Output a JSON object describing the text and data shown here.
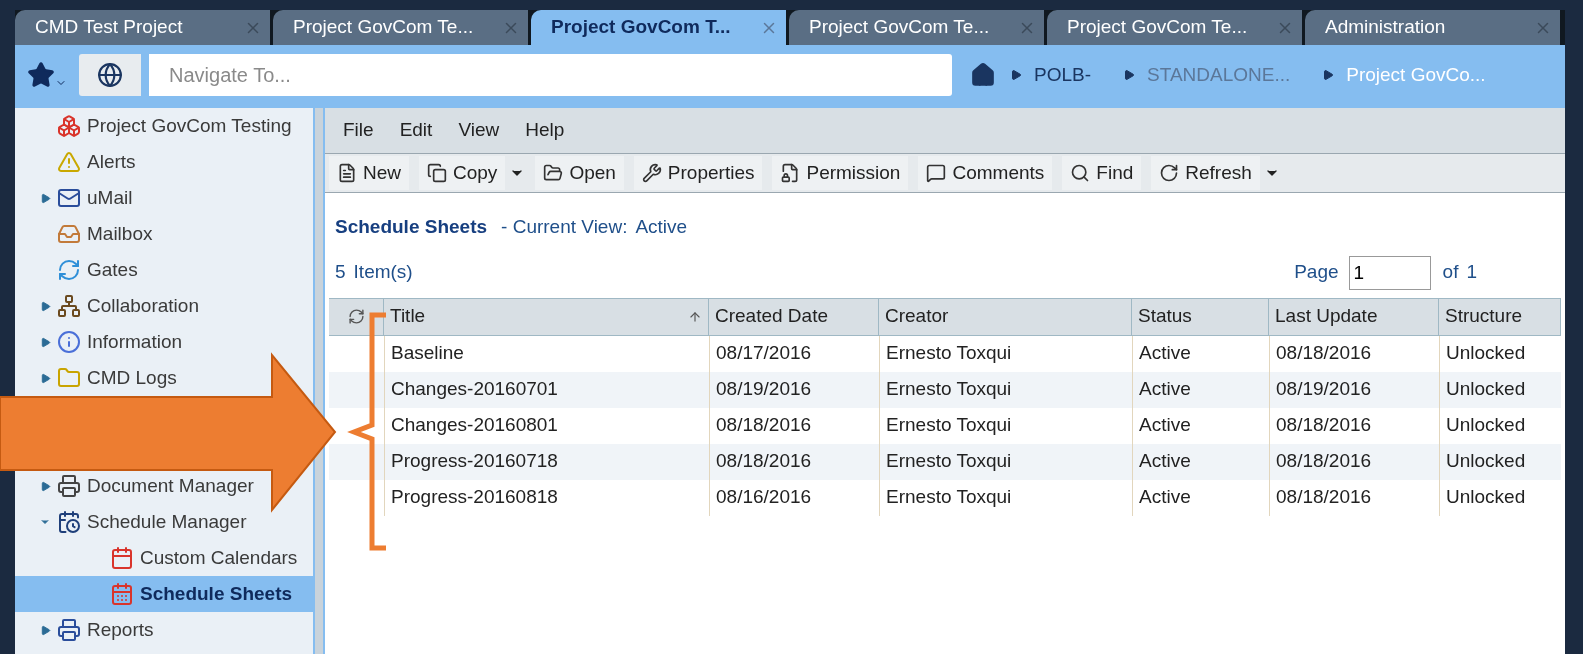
{
  "tabs": [
    {
      "label": "CMD Test Project",
      "selected": false
    },
    {
      "label": "Project GovCom Te...",
      "selected": false
    },
    {
      "label": "Project GovCom T...",
      "selected": true
    },
    {
      "label": "Project GovCom Te...",
      "selected": false
    },
    {
      "label": "Project GovCom Te...",
      "selected": false
    },
    {
      "label": "Administration",
      "selected": false
    }
  ],
  "navigation": {
    "placeholder": "Navigate To...",
    "breadcrumbs": [
      {
        "label": "POLB-",
        "color": "#1a3560"
      },
      {
        "label": "STANDALONE...",
        "color": "#5b7799"
      },
      {
        "label": "Project GovCo...",
        "color": "#ffffff"
      }
    ]
  },
  "sidebar": {
    "items": [
      {
        "label": "Project GovCom Testing",
        "selected": false
      },
      {
        "label": "Alerts",
        "selected": false
      },
      {
        "label": "uMail",
        "selected": false,
        "expanded": false
      },
      {
        "label": "Mailbox",
        "selected": false
      },
      {
        "label": "Gates",
        "selected": false
      },
      {
        "label": "Collaboration",
        "selected": false,
        "expanded": false
      },
      {
        "label": "Information",
        "selected": false,
        "expanded": false
      },
      {
        "label": "CMD Logs",
        "selected": false,
        "expanded": false
      },
      {
        "label": "Document Manager",
        "selected": false,
        "expanded": false
      },
      {
        "label": "Schedule Manager",
        "selected": false,
        "expanded": true,
        "children": [
          {
            "label": "Custom Calendars",
            "selected": false
          },
          {
            "label": "Schedule Sheets",
            "selected": true
          }
        ]
      },
      {
        "label": "Reports",
        "selected": false,
        "expanded": false
      }
    ]
  },
  "menu": [
    "File",
    "Edit",
    "View",
    "Help"
  ],
  "toolbar": [
    {
      "label": "New",
      "menu": false
    },
    {
      "label": "Copy",
      "menu": true
    },
    {
      "label": "Open",
      "menu": false
    },
    {
      "label": "Properties",
      "menu": false
    },
    {
      "label": "Permission",
      "menu": false
    },
    {
      "label": "Comments",
      "menu": false
    },
    {
      "label": "Find",
      "menu": false
    },
    {
      "label": "Refresh",
      "menu": true
    }
  ],
  "header": {
    "title": "Schedule Sheets",
    "view_label": "- Current View:",
    "view": "Active",
    "count": "5",
    "count_label": "Item(s)",
    "page_label": "Page",
    "page": "1",
    "of_label": "of",
    "pages": "1"
  },
  "table": {
    "columns": [
      {
        "label": "Title",
        "sorted": true
      },
      {
        "label": "Created Date",
        "sorted": false
      },
      {
        "label": "Creator",
        "sorted": false
      },
      {
        "label": "Status",
        "sorted": false
      },
      {
        "label": "Last Update",
        "sorted": false
      },
      {
        "label": "Structure",
        "sorted": false
      }
    ],
    "rows": [
      [
        "Baseline",
        "08/17/2016",
        "Ernesto Toxqui",
        "Active",
        "08/18/2016",
        "Unlocked"
      ],
      [
        "Changes-20160701",
        "08/19/2016",
        "Ernesto Toxqui",
        "Active",
        "08/19/2016",
        "Unlocked"
      ],
      [
        "Changes-20160801",
        "08/18/2016",
        "Ernesto Toxqui",
        "Active",
        "08/18/2016",
        "Unlocked"
      ],
      [
        "Progress-20160718",
        "08/18/2016",
        "Ernesto Toxqui",
        "Active",
        "08/18/2016",
        "Unlocked"
      ],
      [
        "Progress-20160818",
        "08/16/2016",
        "Ernesto Toxqui",
        "Active",
        "08/18/2016",
        "Unlocked"
      ]
    ]
  }
}
